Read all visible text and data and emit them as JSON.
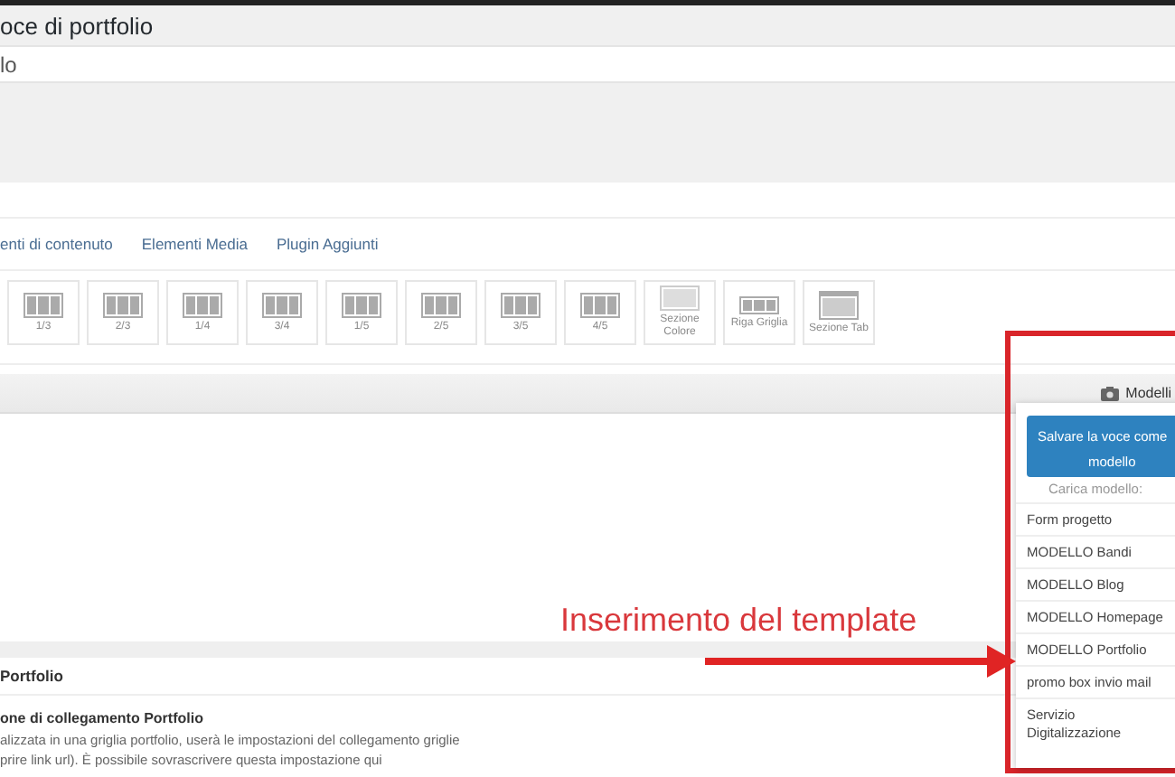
{
  "page_title": "oce di portfolio",
  "title_field": {
    "value": "lo"
  },
  "tabs": [
    {
      "label": "enti di contenuto",
      "selected": false
    },
    {
      "label": "Elementi Media",
      "selected": false
    },
    {
      "label": "Plugin Aggiunti",
      "selected": false
    }
  ],
  "elements": [
    {
      "kind": "columns",
      "label": "1/3"
    },
    {
      "kind": "columns",
      "label": "2/3"
    },
    {
      "kind": "columns",
      "label": "1/4"
    },
    {
      "kind": "columns",
      "label": "3/4"
    },
    {
      "kind": "columns",
      "label": "1/5"
    },
    {
      "kind": "columns",
      "label": "2/5"
    },
    {
      "kind": "columns",
      "label": "3/5"
    },
    {
      "kind": "columns",
      "label": "4/5"
    },
    {
      "kind": "color-section",
      "label": "Sezione Colore"
    },
    {
      "kind": "grid-row",
      "label": "Riga Griglia"
    },
    {
      "kind": "tab-section",
      "label": "Sezione Tab"
    }
  ],
  "templates_button": {
    "label": "Modelli"
  },
  "templates_menu": {
    "save_button_lines": [
      "Salvare la voce come",
      "modello"
    ],
    "load_label": "Carica modello:",
    "items": [
      "Form progetto",
      "MODELLO Bandi",
      "MODELLO Blog",
      "MODELLO Homepage",
      "MODELLO Portfolio",
      "promo box invio mail",
      "Servizio Digitalizzazione"
    ]
  },
  "annotation": {
    "text": "Inserimento del template"
  },
  "portfolio_box": {
    "title": "Portfolio",
    "field_label": "one di collegamento Portfolio",
    "description": [
      "alizzata in una griglia portfolio, userà le impostazioni del collegamento griglie",
      "prire link url). È possibile sovrascrivere questa impostazione qui"
    ]
  }
}
